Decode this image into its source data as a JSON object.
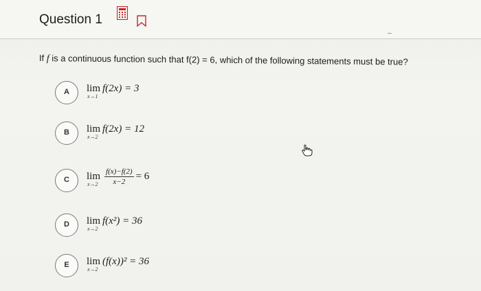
{
  "question": {
    "title": "Question 1",
    "prompt_pre": "If ",
    "prompt_f": "f",
    "prompt_post": " is a continuous function such that f(2) = 6, which of the following statements must be true?"
  },
  "icons": {
    "calculator": "calculator-icon",
    "bookmark": "bookmark-icon",
    "cursor": "hand-pointer-icon"
  },
  "choices": [
    {
      "letter": "A",
      "lim": "lim",
      "sub": "x→1",
      "expr": "f(2x) = 3"
    },
    {
      "letter": "B",
      "lim": "lim",
      "sub": "x→2",
      "expr": "f(2x) = 12"
    },
    {
      "letter": "C",
      "lim": "lim",
      "sub": "x→2",
      "num": "f(x)−f(2)",
      "den": "x−2",
      "rhs": "= 6"
    },
    {
      "letter": "D",
      "lim": "lim",
      "sub": "x→2",
      "expr": "f(x²) = 36"
    },
    {
      "letter": "E",
      "lim": "lim",
      "sub": "x→2",
      "expr": "(f(x))² = 36"
    }
  ],
  "colors": {
    "accent_calculator": "#c62828"
  }
}
